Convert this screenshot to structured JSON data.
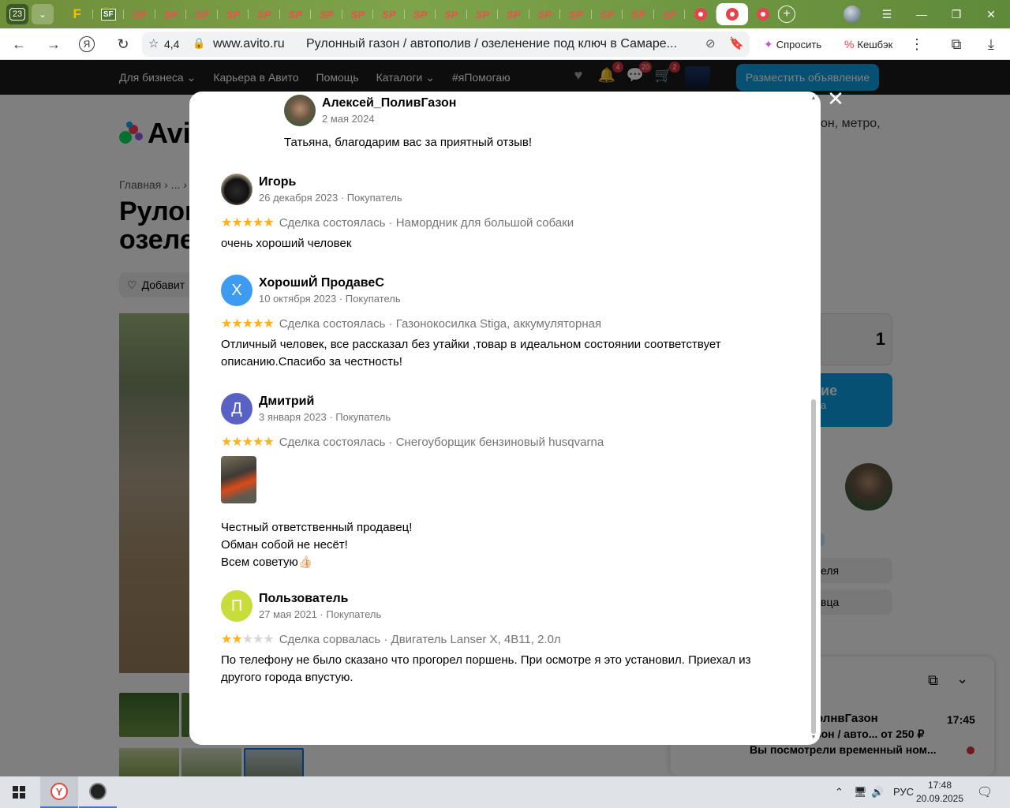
{
  "browser": {
    "tab_count": "23",
    "tabs": [
      {
        "kind": "f",
        "label": "F"
      },
      {
        "kind": "sf",
        "label": "SF"
      },
      {
        "kind": "sp",
        "label": "SP"
      },
      {
        "kind": "sp",
        "label": "SP"
      },
      {
        "kind": "sp",
        "label": "SP"
      },
      {
        "kind": "sp",
        "label": "SP"
      },
      {
        "kind": "sp",
        "label": "SP"
      },
      {
        "kind": "sp",
        "label": "SP"
      },
      {
        "kind": "sp",
        "label": "SP"
      },
      {
        "kind": "sp",
        "label": "SP"
      },
      {
        "kind": "sp",
        "label": "SP"
      },
      {
        "kind": "sp",
        "label": "SP"
      },
      {
        "kind": "sp",
        "label": "SP"
      },
      {
        "kind": "sp",
        "label": "SP"
      },
      {
        "kind": "sp",
        "label": "SP"
      },
      {
        "kind": "sp",
        "label": "SP"
      },
      {
        "kind": "sp",
        "label": "SP"
      },
      {
        "kind": "sp",
        "label": "SP"
      },
      {
        "kind": "sp",
        "label": "SP"
      },
      {
        "kind": "sp",
        "label": "SP"
      },
      {
        "kind": "rec",
        "label": ""
      },
      {
        "kind": "rec-active",
        "label": ""
      },
      {
        "kind": "rec",
        "label": ""
      }
    ],
    "site_rating": "4,4",
    "domain": "www.avito.ru",
    "page_title": "Рулонный газон / автополив / озеленение под ключ в Самаре...",
    "ask_label": "Спросить",
    "cashback_label": "Кешбэк"
  },
  "site": {
    "menu": [
      "Для бизнеса ⌄",
      "Карьера в Авито",
      "Помощь",
      "Каталоги ⌄",
      "#яПомогаю"
    ],
    "badges": {
      "notifications": "4",
      "messages": "20",
      "cart": "2"
    },
    "post_button": "Разместить объявление"
  },
  "page_bg": {
    "logo": "Avito",
    "breadcrumbs": "Главная  ›  ...  ›",
    "title_line1": "Рулон",
    "title_line2": "озеле",
    "favorite": "Добавит",
    "right_text": "он, метро,",
    "price_fragment": "1",
    "call_fragment1": "ие",
    "call_fragment2": "а",
    "tag_fragment": "е",
    "btn1_fragment": "еля",
    "btn2_fragment": "вца",
    "chat": {
      "seller": "олнвГазон",
      "time": "17:45",
      "ad": "зон / авто...  от 250 ₽",
      "last_message": "Вы посмотрели временный ном..."
    }
  },
  "reviews": {
    "reply": {
      "author": "Алексей_ПоливГазон",
      "date": "2 мая 2024",
      "text": "Татьяна, благодарим вас за приятный отзыв!"
    },
    "items": [
      {
        "initial": "",
        "avatar": "dog-photo",
        "name": "Игорь",
        "meta": "26 декабря 2023 · Покупатель",
        "rating": 5,
        "deal": "Сделка состоялась · Намордник для большой собаки",
        "text": "очень хороший человек"
      },
      {
        "initial": "Х",
        "avatar_color": "#3d9bf0",
        "name": "ХорошиЙ ПродавеС",
        "meta": "10 октября 2023 · Покупатель",
        "rating": 5,
        "deal": "Сделка состоялась · Газонокосилка Stiga, аккумуляторная",
        "text": "Отличный человек, все рассказал без утайки ,товар в идеальном состоянии соответствует описанию.Спасибо за честность!"
      },
      {
        "initial": "Д",
        "avatar_color": "#5a61c4",
        "name": "Дмитрий",
        "meta": "3 января 2023 · Покупатель",
        "rating": 5,
        "deal": "Сделка состоялась · Снегоуборщик бензиновый husqvarna",
        "has_photo": true,
        "text": "Честный ответственный продавец!\nОбман собой не несёт!\nВсем советую👍🏻"
      },
      {
        "initial": "П",
        "avatar_color": "#c8dc3a",
        "name": "Пользователь",
        "meta": "27 мая 2021 · Покупатель",
        "rating": 2,
        "deal": "Сделка сорвалась · Двигатель Lanser X, 4В11, 2.0л",
        "text": "По телефону не было сказано что прогорел поршень. При осмотре я это установил. Приехал из другого города впустую."
      }
    ]
  },
  "taskbar": {
    "lang": "РУС",
    "time": "17:48",
    "date": "20.09.2025"
  }
}
